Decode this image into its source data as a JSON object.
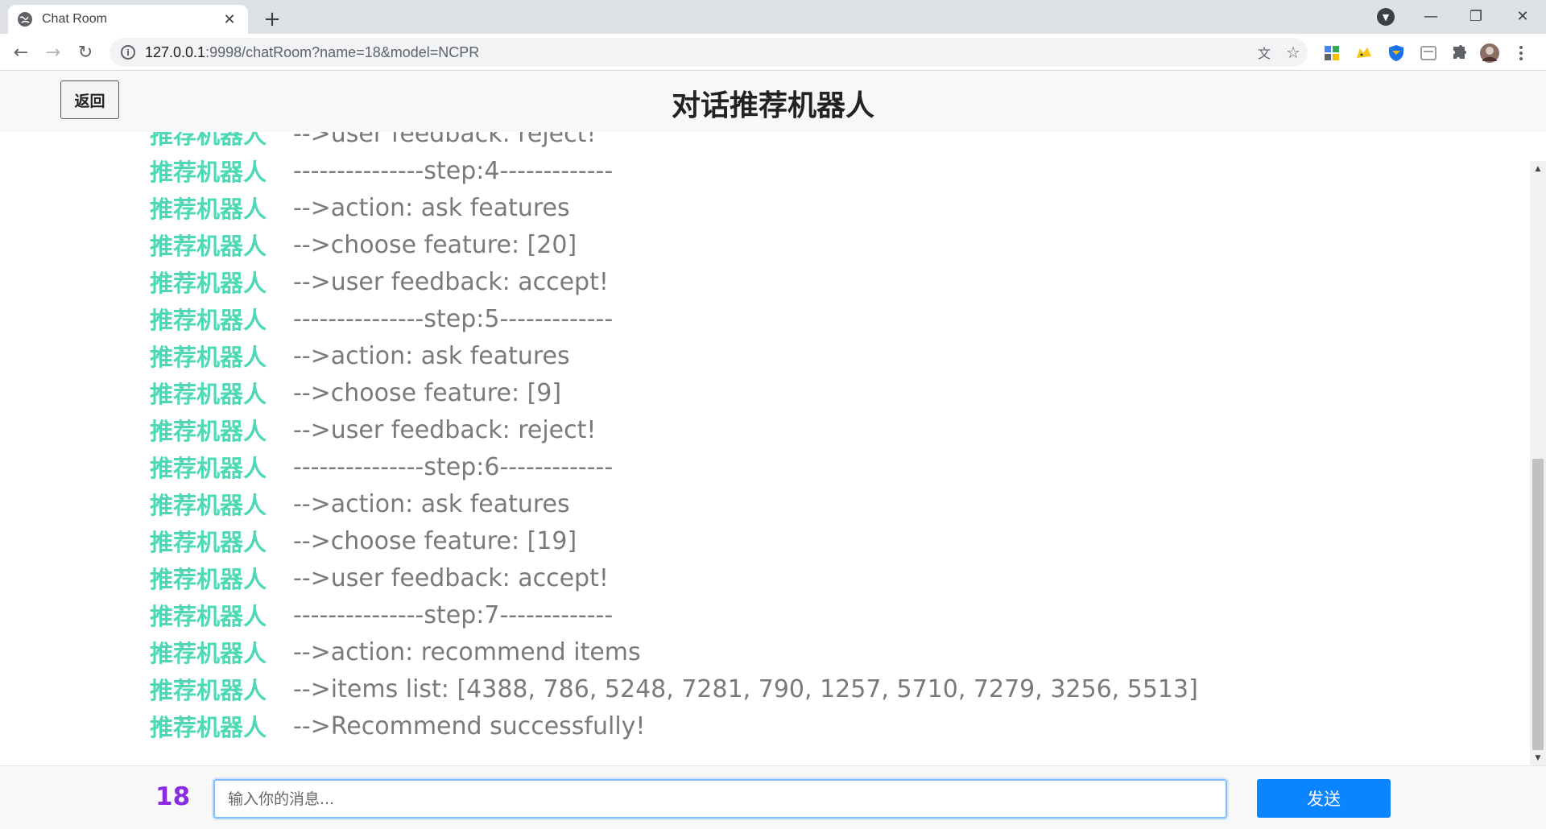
{
  "browser": {
    "tab_title": "Chat Room",
    "url_host": "127.0.0.1",
    "url_rest": ":9998/chatRoom?name=18&model=NCPR",
    "new_tab_symbol": "+",
    "close_symbol": "✕",
    "minimize_symbol": "—",
    "restore_symbol": "❐",
    "window_close_symbol": "✕",
    "back_symbol": "←",
    "forward_symbol": "→",
    "reload_symbol": "↻",
    "info_symbol": "i",
    "translate_symbol": "文",
    "star_symbol": "☆",
    "tab_search_symbol": "▼",
    "extension_icons": [
      "apps-extension-icon",
      "pikachu-extension-icon",
      "shield-extension-icon",
      "reader-extension-icon",
      "puzzle-extensions-icon",
      "profile-avatar-icon",
      "menu-dots-icon"
    ],
    "accent_color": "#0a84ff"
  },
  "header": {
    "back_label": "返回",
    "title": "对话推荐机器人"
  },
  "chat": {
    "sender_color": "#4ed8b6",
    "messages": [
      {
        "sender": "推荐机器人",
        "text": "-->user feedback: reject!"
      },
      {
        "sender": "推荐机器人",
        "text": "---------------step:4-------------"
      },
      {
        "sender": "推荐机器人",
        "text": "-->action: ask features"
      },
      {
        "sender": "推荐机器人",
        "text": "-->choose feature: [20]"
      },
      {
        "sender": "推荐机器人",
        "text": "-->user feedback: accept!"
      },
      {
        "sender": "推荐机器人",
        "text": "---------------step:5-------------"
      },
      {
        "sender": "推荐机器人",
        "text": "-->action: ask features"
      },
      {
        "sender": "推荐机器人",
        "text": "-->choose feature: [9]"
      },
      {
        "sender": "推荐机器人",
        "text": "-->user feedback: reject!"
      },
      {
        "sender": "推荐机器人",
        "text": "---------------step:6-------------"
      },
      {
        "sender": "推荐机器人",
        "text": "-->action: ask features"
      },
      {
        "sender": "推荐机器人",
        "text": "-->choose feature: [19]"
      },
      {
        "sender": "推荐机器人",
        "text": "-->user feedback: accept!"
      },
      {
        "sender": "推荐机器人",
        "text": "---------------step:7-------------"
      },
      {
        "sender": "推荐机器人",
        "text": "-->action: recommend items"
      },
      {
        "sender": "推荐机器人",
        "text": "-->items list: [4388, 786, 5248, 7281, 790, 1257, 5710, 7279, 3256, 5513]"
      },
      {
        "sender": "推荐机器人",
        "text": "-->Recommend successfully!"
      }
    ]
  },
  "footer": {
    "user_id": "18",
    "input_value": "",
    "input_placeholder": "输入你的消息...",
    "send_label": "发送"
  }
}
